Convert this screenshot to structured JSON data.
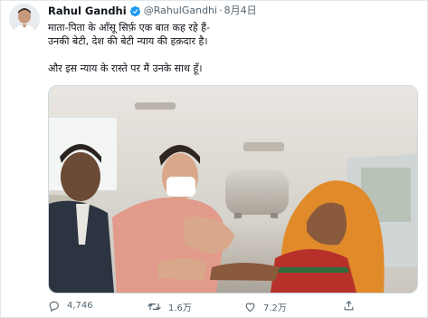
{
  "author": {
    "name": "Rahul Gandhi",
    "handle": "@RahulGandhi",
    "separator": "·",
    "date": "8月4日",
    "verified_color": "#1d9bf0"
  },
  "tweet": {
    "lines": [
      "माता-पिता के आँसू सिर्फ़ एक बात कह रहे हैं-",
      "उनकी बेटी, देश की बेटी न्याय की हक़दार है।",
      "और इस न्याय के रास्ते पर मैं उनके साथ हूँ।"
    ]
  },
  "actions": {
    "reply": {
      "icon": "reply-icon",
      "count": "4,746"
    },
    "retweet": {
      "icon": "retweet-icon",
      "count": "1.6万"
    },
    "like": {
      "icon": "heart-icon",
      "count": "7.2万"
    },
    "share": {
      "icon": "share-icon"
    }
  },
  "colors": {
    "text": "#0f1419",
    "secondary": "#536471",
    "accent": "#1d9bf0"
  }
}
